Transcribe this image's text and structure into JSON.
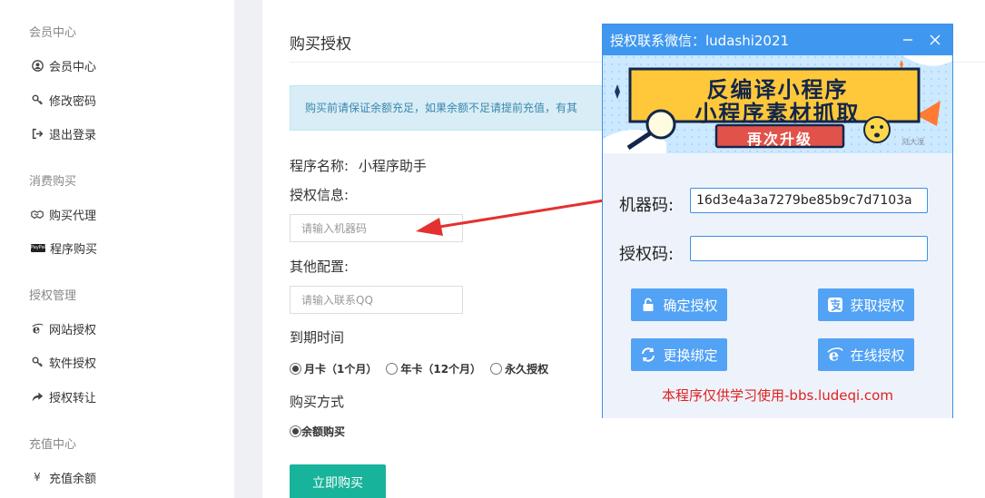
{
  "sidebar": {
    "sections": [
      {
        "title": "会员中心",
        "items": [
          {
            "label": "会员中心",
            "icon": "user-circle-icon"
          },
          {
            "label": "修改密码",
            "icon": "key-icon"
          },
          {
            "label": "退出登录",
            "icon": "logout-icon"
          }
        ]
      },
      {
        "title": "消费购买",
        "items": [
          {
            "label": "购买代理",
            "icon": "handshake-icon"
          },
          {
            "label": "程序购买",
            "icon": "paypal-icon"
          }
        ]
      },
      {
        "title": "授权管理",
        "items": [
          {
            "label": "网站授权",
            "icon": "ie-icon"
          },
          {
            "label": "软件授权",
            "icon": "key-icon"
          },
          {
            "label": "授权转让",
            "icon": "share-icon"
          }
        ]
      },
      {
        "title": "充值中心",
        "items": [
          {
            "label": "充值余额",
            "icon": "yen-icon"
          }
        ]
      }
    ]
  },
  "main": {
    "title": "购买授权",
    "notice": "购买前请保证余额充足，如果余额不足请提前充值，有其",
    "program_name_label": "程序名称:",
    "program_name_value": "小程序助手",
    "auth_info_label": "授权信息:",
    "machine_placeholder": "请输入机器码",
    "other_config_label": "其他配置:",
    "qq_placeholder": "请输入联系QQ",
    "expire_label": "到期时间",
    "expire_options": [
      {
        "label": "月卡（1个月）",
        "selected": true
      },
      {
        "label": "年卡（12个月）",
        "selected": false
      },
      {
        "label": "永久授权",
        "selected": false
      }
    ],
    "pay_method_label": "购买方式",
    "pay_method_option": "余额购买",
    "buy_button": "立即购买"
  },
  "dialog": {
    "title": "授权联系微信：ludashi2021",
    "banner": {
      "line1": "反编译小程序",
      "line2": "小程序素材抓取",
      "line3": "再次升级",
      "watermark": "陆大湿"
    },
    "machine_label": "机器码:",
    "machine_value": "16d3e4a3a7279be85b9c7d7103a",
    "auth_label": "授权码:",
    "auth_value": "",
    "buttons": {
      "confirm": "确定授权",
      "get": "获取授权",
      "rebind": "更换绑定",
      "online": "在线授权"
    },
    "disclaimer": "本程序仅供学习使用-bbs.ludeqi.com"
  },
  "colors": {
    "accent": "#3f97ef",
    "buy_button": "#18b39b",
    "notice_bg": "#d9edf7",
    "arrow": "#e53030",
    "disclaimer": "#e02020"
  }
}
